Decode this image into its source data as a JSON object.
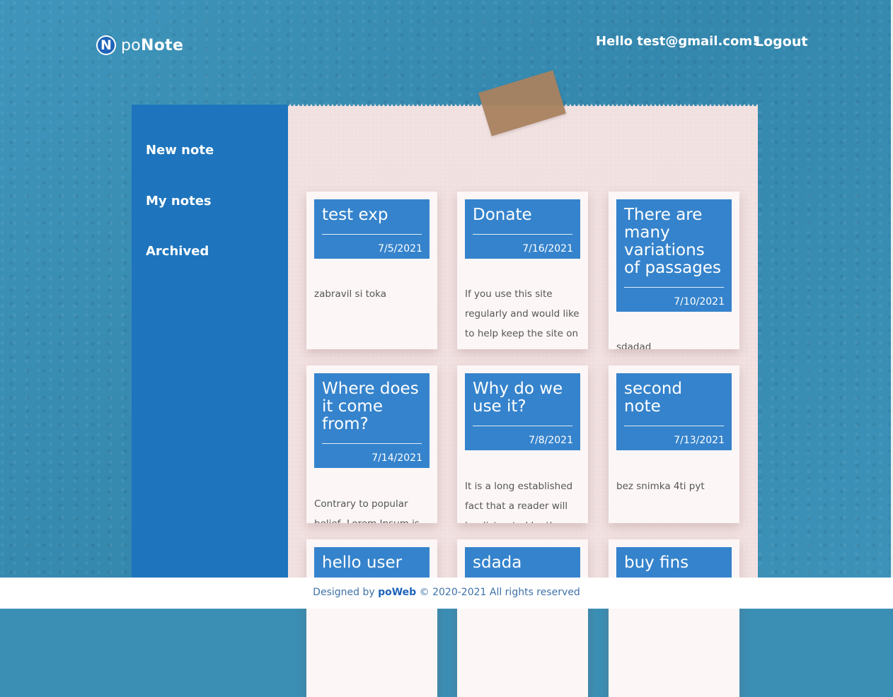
{
  "app": {
    "logo_letter": "N",
    "logo_prefix": "po",
    "logo_suffix": "Note"
  },
  "header": {
    "greeting": "Hello test@gmail.com!",
    "logout_label": "Logout"
  },
  "sidebar": {
    "items": [
      {
        "label": "New note"
      },
      {
        "label": "My notes"
      },
      {
        "label": "Archived"
      }
    ]
  },
  "notes": [
    {
      "title": "test exp",
      "date": "7/5/2021",
      "body": "zabravil si toka"
    },
    {
      "title": "Donate",
      "date": "7/16/2021",
      "body": "If you use this site regularly and would like to help keep the site on"
    },
    {
      "title": "There are many variations of passages",
      "date": "7/10/2021",
      "body": "sdadad"
    },
    {
      "title": "Where does it come from?",
      "date": "7/14/2021",
      "body": "Contrary to popular belief, Lorem Ipsum is"
    },
    {
      "title": "Why do we use it?",
      "date": "7/8/2021",
      "body": "It is a long established fact that a reader will be distracted by the"
    },
    {
      "title": "second note",
      "date": "7/13/2021",
      "body": "bez snimka 4ti pyt"
    },
    {
      "title": "hello user",
      "date": "",
      "body": ""
    },
    {
      "title": "sdada",
      "date": "",
      "body": ""
    },
    {
      "title": "buy fins",
      "date": "",
      "body": ""
    }
  ],
  "footer": {
    "prefix": "Designed by",
    "brand": "poWeb",
    "suffix": "© 2020-2021 All rights reserved"
  },
  "colors": {
    "sidebar": "#1e75bd",
    "card_header": "#3583cc",
    "paper": "#f1e0e0",
    "background": "#3b8fb5"
  }
}
